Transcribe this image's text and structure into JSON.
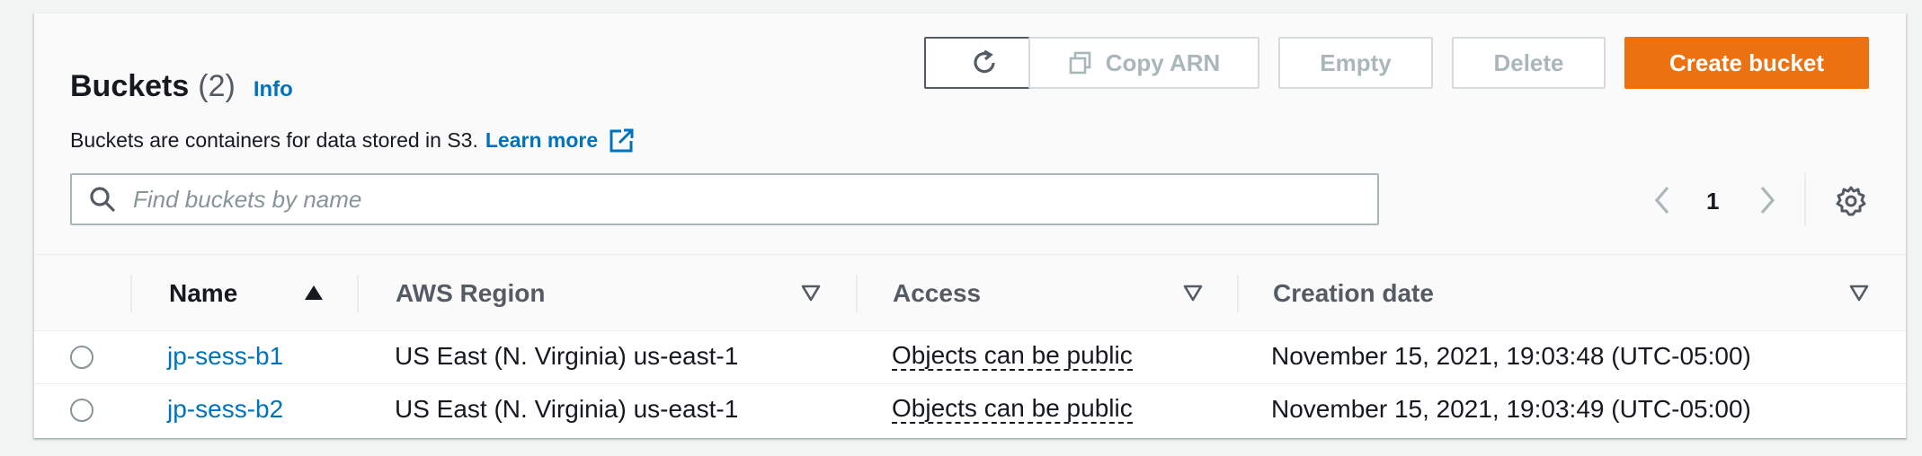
{
  "header": {
    "title": "Buckets",
    "count": "(2)",
    "info_label": "Info",
    "description": "Buckets are containers for data stored in S3.",
    "learn_more": "Learn more"
  },
  "toolbar": {
    "refresh_icon": "refresh-icon",
    "copy_arn_label": "Copy ARN",
    "empty_label": "Empty",
    "delete_label": "Delete",
    "create_label": "Create bucket"
  },
  "search": {
    "placeholder": "Find buckets by name",
    "value": ""
  },
  "pagination": {
    "current_page": "1"
  },
  "table": {
    "columns": [
      "Name",
      "AWS Region",
      "Access",
      "Creation date"
    ],
    "rows": [
      {
        "name": "jp-sess-b1",
        "region": "US East (N. Virginia) us-east-1",
        "access": "Objects can be public",
        "created": "November 15, 2021, 19:03:48 (UTC-05:00)"
      },
      {
        "name": "jp-sess-b2",
        "region": "US East (N. Virginia) us-east-1",
        "access": "Objects can be public",
        "created": "November 15, 2021, 19:03:49 (UTC-05:00)"
      }
    ]
  },
  "colors": {
    "primary_button": "#ec7211",
    "link": "#0073bb",
    "text": "#16191f",
    "muted": "#aab7b8"
  }
}
